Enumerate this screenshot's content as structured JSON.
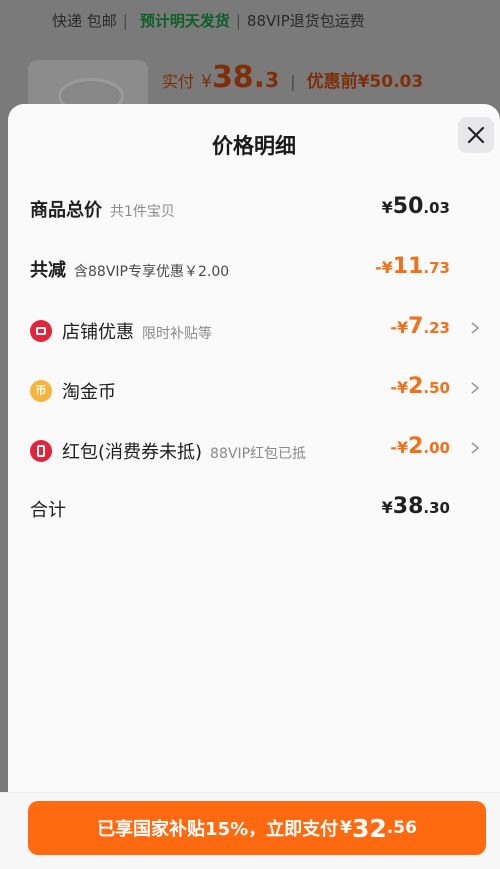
{
  "background": {
    "shipping": "快递 包邮",
    "estimate": "预计明天发货",
    "sep": "|",
    "return_shipping": "88VIP退货包运费",
    "price_label": "实付",
    "price_currency": "¥",
    "price_int": "38.",
    "price_dec": "3",
    "pre_discount": "优惠前¥50.03"
  },
  "sheet": {
    "title": "价格明细",
    "close_icon": "close-icon",
    "rows": [
      {
        "label": "商品总价",
        "sub": "共1件宝贝",
        "cur": "¥",
        "int": "50",
        "dec": ".03"
      },
      {
        "label": "共减",
        "sub": "含88VIP专享优惠￥2.00",
        "cur": "-¥",
        "int": "11",
        "dec": ".73"
      },
      {
        "label": "店铺优惠",
        "sub": "限时补贴等",
        "cur": "-¥",
        "int": "7",
        "dec": ".23",
        "icon": "shop-icon"
      },
      {
        "label": "淘金币",
        "sub": "",
        "cur": "-¥",
        "int": "2",
        "dec": ".50",
        "icon": "coin-icon"
      },
      {
        "label": "红包(消费券未抵)",
        "sub": "88VIP红包已抵",
        "cur": "-¥",
        "int": "2",
        "dec": ".00",
        "icon": "red-packet-icon"
      },
      {
        "label": "合计",
        "sub": "",
        "cur": "¥",
        "int": "38",
        "dec": ".30"
      }
    ]
  },
  "paybar": {
    "text": "已享国家补贴15%，立即支付",
    "cur": "¥",
    "int": "32",
    "dec": ".56"
  },
  "colors": {
    "accent": "#ff6a10",
    "discount": "#f27018",
    "shop_icon": "#e1263b",
    "coin_icon": "#f6b43a"
  }
}
